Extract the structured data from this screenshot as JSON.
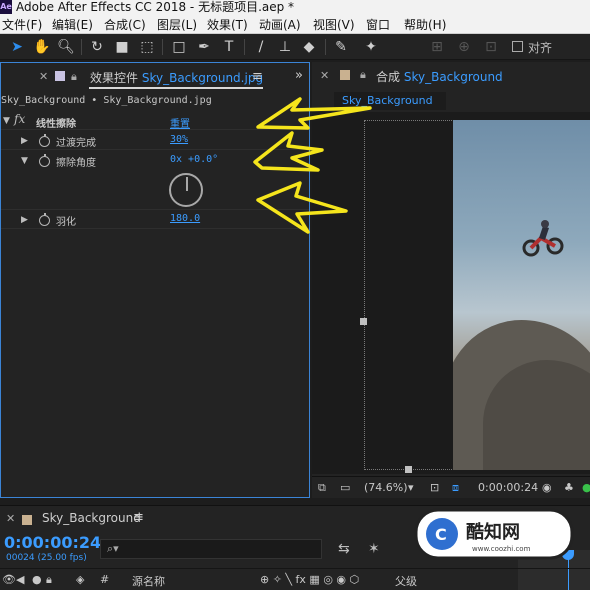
{
  "window": {
    "title": "Adobe After Effects CC 2018 - 无标题项目.aep *",
    "logo": "Ae"
  },
  "menu": [
    {
      "label": "文件(F)"
    },
    {
      "label": "编辑(E)"
    },
    {
      "label": "合成(C)"
    },
    {
      "label": "图层(L)"
    },
    {
      "label": "效果(T)"
    },
    {
      "label": "动画(A)"
    },
    {
      "label": "视图(V)"
    },
    {
      "label": "窗口"
    },
    {
      "label": "帮助(H)"
    }
  ],
  "toolbar": {
    "tools": [
      "selection-tool",
      "hand-tool",
      "zoom-tool",
      "rotate-tool",
      "camera-tool",
      "pan-behind-tool",
      "rectangle-tool",
      "pen-tool",
      "type-tool",
      "brush-tool",
      "clone-stamp-tool",
      "eraser-tool",
      "roto-brush-tool",
      "puppet-pin-tool"
    ],
    "snap_label": "对齐"
  },
  "effect_controls": {
    "tab_label": "效果控件",
    "tab_layer": "Sky_Background.jpg",
    "layer_path": "Sky_Background • Sky_Background.jpg",
    "effect": {
      "fx": "fx",
      "name": "线性擦除",
      "reset_label": "重置",
      "properties": [
        {
          "label": "过渡完成",
          "value": "30%"
        },
        {
          "label": "擦除角度",
          "value": "0x +0.0°"
        },
        {
          "label": "羽化",
          "value": "180.0"
        }
      ]
    }
  },
  "composition": {
    "tab_prefix": "合成",
    "tab_name": "Sky_Background",
    "subtab": "Sky_Background",
    "footer": {
      "zoom": "(74.6%)",
      "timecode": "0:00:00:24"
    }
  },
  "timeline": {
    "comp_name": "Sky_Background",
    "timecode": "0:00:00:24",
    "frames": "00024 (25.00 fps)",
    "search_placeholder": "",
    "columns": {
      "hash": "#",
      "source_name": "源名称",
      "parent": "父级"
    }
  },
  "watermark": {
    "brand": "酷知网",
    "url": "www.coozhi.com"
  },
  "colors": {
    "accent": "#3b9cff",
    "annotation": "#f5e51c",
    "panel": "#232323"
  }
}
